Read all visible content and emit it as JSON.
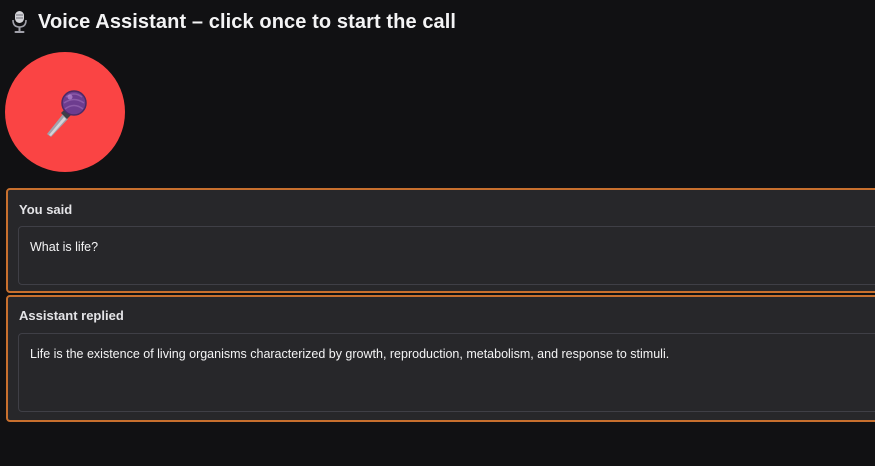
{
  "header": {
    "title": "Voice Assistant – click once to start the call",
    "icon": "microphone-icon"
  },
  "mic_button": {
    "icon": "microphone-icon",
    "color": "#fa4444"
  },
  "you_said": {
    "label": "You said",
    "value": "What is life?"
  },
  "assistant_replied": {
    "label": "Assistant replied",
    "value": "Life is the existence of living organisms characterized by growth, reproduction, metabolism, and response to stimuli."
  },
  "colors": {
    "background": "#111113",
    "panel": "#27272a",
    "accent_border": "#c8702e"
  }
}
